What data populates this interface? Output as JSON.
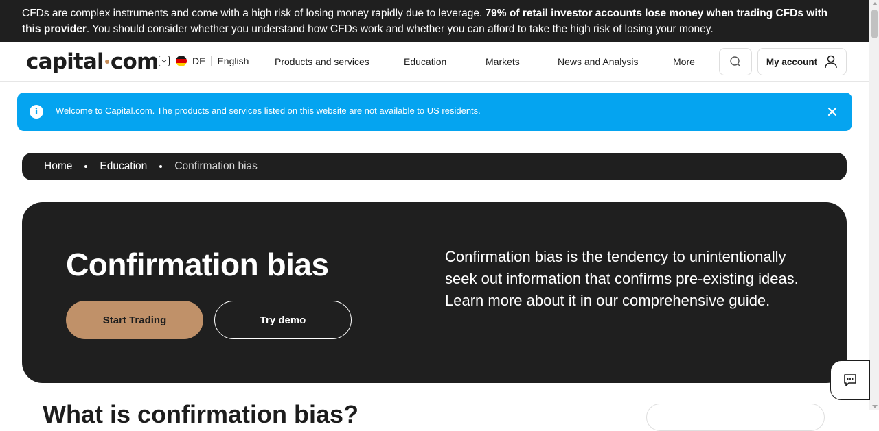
{
  "risk_warning": {
    "text_start": "CFDs are complex instruments and come with a high risk of losing money rapidly due to leverage. ",
    "text_bold": "79% of retail investor accounts lose money when trading CFDs with this provider",
    "text_end": ". You should consider whether you understand how CFDs work and whether you can afford to take the high risk of losing your money."
  },
  "header": {
    "logo_left": "capital",
    "logo_right": "com",
    "country_code": "DE",
    "language": "English",
    "nav": [
      "Products and services",
      "Education",
      "Markets",
      "News and Analysis",
      "More"
    ],
    "account_label": "My account"
  },
  "notice": {
    "text": "Welcome to Capital.com. The products and services listed on this website are not available to US residents."
  },
  "breadcrumb": [
    "Home",
    "Education",
    "Confirmation bias"
  ],
  "hero": {
    "title": "Confirmation bias",
    "primary_button": "Start Trading",
    "secondary_button": "Try demo",
    "description": "Confirmation bias is the tendency to unintentionally seek out information that confirms pre-existing ideas. Learn more about it in our comprehensive guide."
  },
  "section": {
    "heading": "What is confirmation bias?"
  },
  "colors": {
    "accent_gold": "#c09169",
    "notice_blue": "#05a4f0",
    "dark": "#1f1f1f"
  },
  "icons": {
    "search": "search-icon",
    "account": "user-icon",
    "info": "info-icon",
    "close": "close-icon",
    "chat": "chat-icon"
  }
}
